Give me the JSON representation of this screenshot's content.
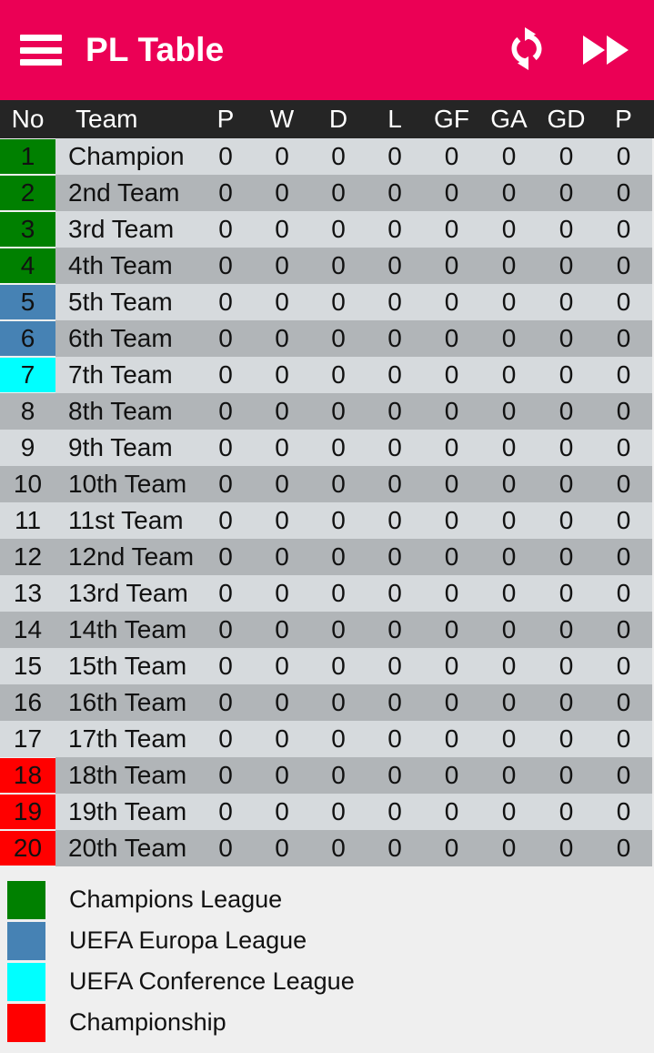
{
  "app_bar": {
    "title": "PL Table",
    "menu_icon": "hamburger-menu-icon",
    "refresh_icon": "refresh-circular-arrows-icon",
    "fast_forward_icon": "fast-forward-double-triangle-icon",
    "background_color": "#EB0055",
    "foreground_color": "#FFFFFF"
  },
  "table": {
    "header_background": "#252525",
    "row_light_background": "#D6DADD",
    "row_dark_background": "#B1B5B8",
    "columns": [
      {
        "key": "no",
        "label": "No"
      },
      {
        "key": "team",
        "label": "Team"
      },
      {
        "key": "p",
        "label": "P"
      },
      {
        "key": "w",
        "label": "W"
      },
      {
        "key": "d",
        "label": "D"
      },
      {
        "key": "l",
        "label": "L"
      },
      {
        "key": "gf",
        "label": "GF"
      },
      {
        "key": "ga",
        "label": "GA"
      },
      {
        "key": "gd",
        "label": "GD"
      },
      {
        "key": "pts",
        "label": "P"
      }
    ],
    "rows": [
      {
        "no": "1",
        "team": "Champion",
        "p": "0",
        "w": "0",
        "d": "0",
        "l": "0",
        "gf": "0",
        "ga": "0",
        "gd": "0",
        "pts": "0",
        "zone": "ucl"
      },
      {
        "no": "2",
        "team": "2nd Team",
        "p": "0",
        "w": "0",
        "d": "0",
        "l": "0",
        "gf": "0",
        "ga": "0",
        "gd": "0",
        "pts": "0",
        "zone": "ucl"
      },
      {
        "no": "3",
        "team": "3rd Team",
        "p": "0",
        "w": "0",
        "d": "0",
        "l": "0",
        "gf": "0",
        "ga": "0",
        "gd": "0",
        "pts": "0",
        "zone": "ucl"
      },
      {
        "no": "4",
        "team": "4th Team",
        "p": "0",
        "w": "0",
        "d": "0",
        "l": "0",
        "gf": "0",
        "ga": "0",
        "gd": "0",
        "pts": "0",
        "zone": "ucl"
      },
      {
        "no": "5",
        "team": "5th Team",
        "p": "0",
        "w": "0",
        "d": "0",
        "l": "0",
        "gf": "0",
        "ga": "0",
        "gd": "0",
        "pts": "0",
        "zone": "uel"
      },
      {
        "no": "6",
        "team": "6th Team",
        "p": "0",
        "w": "0",
        "d": "0",
        "l": "0",
        "gf": "0",
        "ga": "0",
        "gd": "0",
        "pts": "0",
        "zone": "uel"
      },
      {
        "no": "7",
        "team": "7th Team",
        "p": "0",
        "w": "0",
        "d": "0",
        "l": "0",
        "gf": "0",
        "ga": "0",
        "gd": "0",
        "pts": "0",
        "zone": "uecl"
      },
      {
        "no": "8",
        "team": "8th Team",
        "p": "0",
        "w": "0",
        "d": "0",
        "l": "0",
        "gf": "0",
        "ga": "0",
        "gd": "0",
        "pts": "0",
        "zone": "none"
      },
      {
        "no": "9",
        "team": "9th Team",
        "p": "0",
        "w": "0",
        "d": "0",
        "l": "0",
        "gf": "0",
        "ga": "0",
        "gd": "0",
        "pts": "0",
        "zone": "none"
      },
      {
        "no": "10",
        "team": "10th Team",
        "p": "0",
        "w": "0",
        "d": "0",
        "l": "0",
        "gf": "0",
        "ga": "0",
        "gd": "0",
        "pts": "0",
        "zone": "none"
      },
      {
        "no": "11",
        "team": "11st Team",
        "p": "0",
        "w": "0",
        "d": "0",
        "l": "0",
        "gf": "0",
        "ga": "0",
        "gd": "0",
        "pts": "0",
        "zone": "none"
      },
      {
        "no": "12",
        "team": "12nd Team",
        "p": "0",
        "w": "0",
        "d": "0",
        "l": "0",
        "gf": "0",
        "ga": "0",
        "gd": "0",
        "pts": "0",
        "zone": "none"
      },
      {
        "no": "13",
        "team": "13rd Team",
        "p": "0",
        "w": "0",
        "d": "0",
        "l": "0",
        "gf": "0",
        "ga": "0",
        "gd": "0",
        "pts": "0",
        "zone": "none"
      },
      {
        "no": "14",
        "team": "14th Team",
        "p": "0",
        "w": "0",
        "d": "0",
        "l": "0",
        "gf": "0",
        "ga": "0",
        "gd": "0",
        "pts": "0",
        "zone": "none"
      },
      {
        "no": "15",
        "team": "15th Team",
        "p": "0",
        "w": "0",
        "d": "0",
        "l": "0",
        "gf": "0",
        "ga": "0",
        "gd": "0",
        "pts": "0",
        "zone": "none"
      },
      {
        "no": "16",
        "team": "16th Team",
        "p": "0",
        "w": "0",
        "d": "0",
        "l": "0",
        "gf": "0",
        "ga": "0",
        "gd": "0",
        "pts": "0",
        "zone": "none"
      },
      {
        "no": "17",
        "team": "17th Team",
        "p": "0",
        "w": "0",
        "d": "0",
        "l": "0",
        "gf": "0",
        "ga": "0",
        "gd": "0",
        "pts": "0",
        "zone": "none"
      },
      {
        "no": "18",
        "team": "18th Team",
        "p": "0",
        "w": "0",
        "d": "0",
        "l": "0",
        "gf": "0",
        "ga": "0",
        "gd": "0",
        "pts": "0",
        "zone": "rel"
      },
      {
        "no": "19",
        "team": "19th Team",
        "p": "0",
        "w": "0",
        "d": "0",
        "l": "0",
        "gf": "0",
        "ga": "0",
        "gd": "0",
        "pts": "0",
        "zone": "rel"
      },
      {
        "no": "20",
        "team": "20th Team",
        "p": "0",
        "w": "0",
        "d": "0",
        "l": "0",
        "gf": "0",
        "ga": "0",
        "gd": "0",
        "pts": "0",
        "zone": "rel"
      }
    ]
  },
  "legend": {
    "background": "#EFEFEF",
    "items": [
      {
        "label": "Champions League",
        "color": "#008000",
        "zone": "ucl"
      },
      {
        "label": "UEFA Europa League",
        "color": "#4682B4",
        "zone": "uel"
      },
      {
        "label": "UEFA Conference League",
        "color": "#00FFFF",
        "zone": "uecl"
      },
      {
        "label": "Championship",
        "color": "#FF0000",
        "zone": "rel"
      }
    ]
  }
}
